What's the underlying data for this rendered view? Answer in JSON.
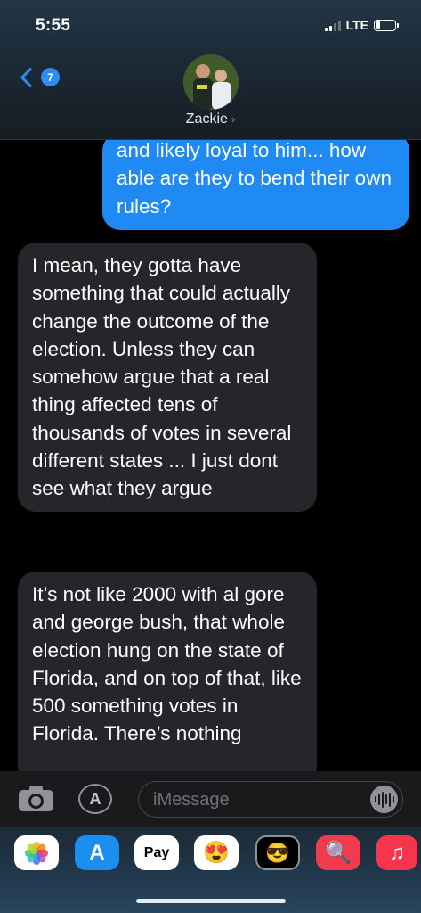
{
  "status_bar": {
    "time": "5:55",
    "network": "LTE",
    "battery_level": 0.2
  },
  "header": {
    "back_count": "7",
    "contact_name": "Zackie",
    "chevron": "›"
  },
  "messages": [
    {
      "direction": "outgoing",
      "text": "and likely loyal to him... how able are they to bend their own rules?"
    },
    {
      "direction": "incoming",
      "text": "I mean, they gotta have something that could actually change the outcome of the election. Unless they can somehow argue that a real thing affected tens of thousands of votes in several different states ... I just dont see what they argue"
    },
    {
      "direction": "incoming",
      "text": "It’s not like 2000 with al gore and george bush, that whole election hung on the state of Florida, and on top of that, like 500 something votes in Florida. There’s nothing"
    }
  ],
  "input_bar": {
    "placeholder": "iMessage",
    "camera_icon": "camera-icon",
    "apps_icon": "app-store-icon",
    "audio_icon": "audio-waveform-icon"
  },
  "app_drawer": {
    "apps": [
      {
        "name": "photos-icon"
      },
      {
        "name": "app-store-icon",
        "glyph": "A"
      },
      {
        "name": "apple-pay-icon",
        "label": "Pay"
      },
      {
        "name": "memoji-icon",
        "glyph": "😍"
      },
      {
        "name": "memoji-sticker-icon",
        "glyph": "😎"
      },
      {
        "name": "web-search-icon",
        "glyph": "🔍"
      },
      {
        "name": "music-icon",
        "glyph": "♫"
      }
    ]
  },
  "colors": {
    "outgoing_bubble": "#1f8af4",
    "incoming_bubble": "#26262a",
    "accent": "#2b8cf3"
  }
}
